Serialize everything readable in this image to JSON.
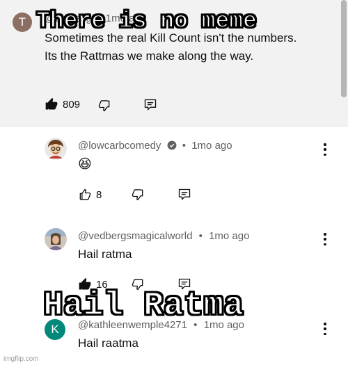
{
  "top_comment": {
    "avatar_letter": "T",
    "avatar_color": "#8d6e63",
    "author_partial": "@traitlesg8y  1mo ago",
    "text": "Sometimes the real Kill Count isn't the numbers. Its the Rattmas we make along the way.",
    "likes": "809"
  },
  "replies": [
    {
      "author": "@lowcarbcomedy",
      "verified": true,
      "time": "1mo ago",
      "text": "😆",
      "likes": "8",
      "like_filled": false
    },
    {
      "author": "@vedbergsmagicalworld",
      "verified": false,
      "time": "1mo ago",
      "text": "Hail ratma",
      "likes": "16",
      "like_filled": true
    },
    {
      "author": "@kathleenwemple4271",
      "verified": false,
      "time": "1mo ago",
      "text": "Hail raatma",
      "avatar_letter": "K",
      "avatar_color": "#00897b"
    }
  ],
  "separator": "•",
  "meme": {
    "top_caption": "There is no meme",
    "bottom_caption": "Hail Ratma"
  },
  "watermark": "imgflip.com"
}
